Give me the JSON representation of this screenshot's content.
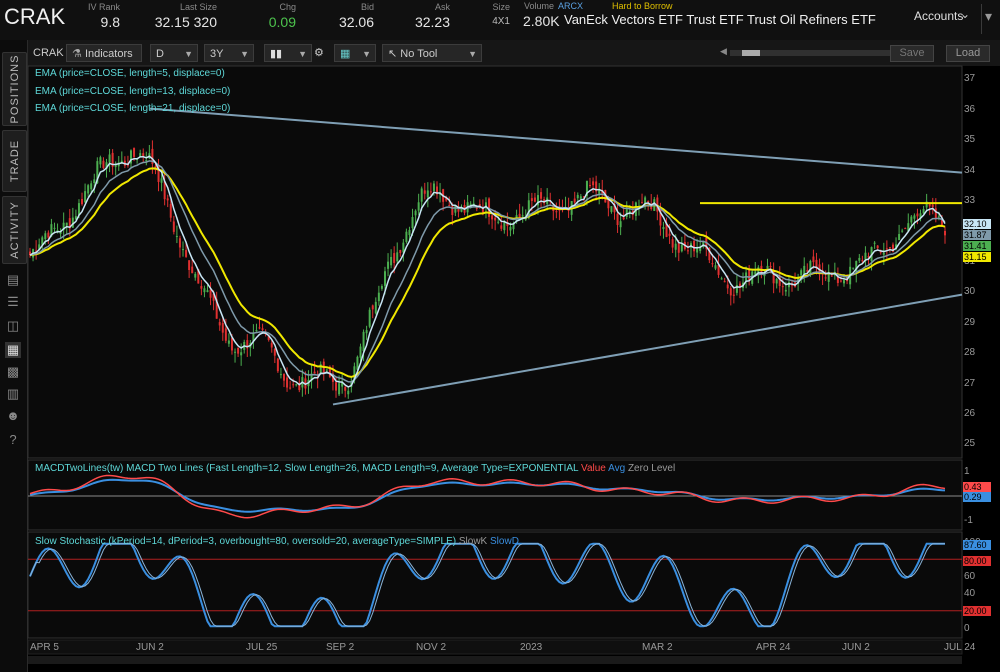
{
  "header": {
    "symbol": "CRAK",
    "ivrank_label": "IV Rank",
    "ivrank": "9.8",
    "lastsize_label": "Last Size",
    "lastsize": "32.15 320",
    "chg_label": "Chg",
    "chg": "0.09",
    "bid_label": "Bid",
    "bid": "32.06",
    "ask_label": "Ask",
    "ask": "32.23",
    "size_label": "Size",
    "size": "4X1",
    "volume_label": "Volume",
    "exchange": "ARCX",
    "volume": "2.80K",
    "htb": "Hard to Borrow",
    "description": "VanEck Vectors ETF Trust ETF Trust Oil Refiners ETF",
    "accounts": "Accounts"
  },
  "sidebar": {
    "tabs": [
      "POSITIONS",
      "TRADE",
      "ACTIVITY"
    ]
  },
  "toolbar": {
    "symbol": "CRAK",
    "studies": "Indicators",
    "aggregation": "D",
    "period": "3Y",
    "drawing_tool": "No Tool",
    "save": "Save",
    "load": "Load"
  },
  "studies": {
    "ema5": "EMA (price=CLOSE, length=5, displace=0)",
    "ema13": "EMA (price=CLOSE, length=13, displace=0)",
    "ema21": "EMA (price=CLOSE, length=21, displace=0)",
    "macd": "MACDTwoLines(tw) MACD Two Lines (Fast Length=12, Slow Length=26, MACD Length=9, Average Type=EXPONENTIAL",
    "macd_value": "Value",
    "macd_avg": "Avg",
    "macd_zero": "Zero Level",
    "stoch": "Slow Stochastic (kPeriod=14, dPeriod=3, overbought=80, oversold=20, averageType=SIMPLE)",
    "stoch_k": "SlowK",
    "stoch_d": "SlowD"
  },
  "price_axis": [
    "37",
    "36",
    "35",
    "34",
    "33",
    "32",
    "31",
    "30",
    "29",
    "28",
    "27",
    "26",
    "25"
  ],
  "price_tags": {
    "ema5": "32.10",
    "ema13": "31.87",
    "last": "31.41",
    "ema21": "31.15"
  },
  "macd_axis": [
    "1",
    "0",
    "-1"
  ],
  "macd_tags": {
    "value": "0.43",
    "avg": "0.29"
  },
  "stoch_axis": [
    "100",
    "80",
    "60",
    "40",
    "20",
    "0"
  ],
  "stoch_tags": {
    "k": "87.60",
    "ob": "80.00",
    "os": "20.00"
  },
  "time_axis": [
    "APR 5",
    "JUN 2",
    "JUL 25",
    "SEP 2",
    "NOV 2",
    "2023",
    "MAR 2",
    "APR 24",
    "JUN 2",
    "JUL 24"
  ],
  "colors": {
    "up": "#4caf50",
    "down": "#e03030",
    "ema5": "#c8e6f5",
    "ema13": "#7f9aaa",
    "ema21": "#f0e800",
    "trend": "#7f9fb5",
    "resistance": "#f0e800",
    "macd_value": "#ff4a4a",
    "macd_avg": "#3a8fe0",
    "stoch_line": "#3a8fe0",
    "stoch_band": "#b02020"
  },
  "chart_data": [
    {
      "type": "line",
      "title": "CRAK daily candlestick",
      "x": [
        "APR 5",
        "JUN 2",
        "JUL 25",
        "SEP 2",
        "NOV 2",
        "2023",
        "MAR 2",
        "APR 24",
        "JUN 2",
        "JUL 24"
      ],
      "series": [
        {
          "name": "CLOSE",
          "values": [
            31.0,
            34.5,
            28.2,
            26.9,
            33.0,
            32.4,
            32.6,
            30.1,
            30.6,
            32.15
          ]
        }
      ],
      "ylim": [
        25,
        37
      ],
      "trendlines": [
        {
          "from": [
            "JUN 2",
            35.8
          ],
          "to": [
            "JUL 24",
            33.7
          ]
        },
        {
          "from": [
            "SEP 2",
            26.1
          ],
          "to": [
            "JUL 24",
            29.7
          ]
        },
        {
          "from": [
            "MAR 2",
            32.7
          ],
          "to": [
            "JUL 24",
            32.7
          ]
        }
      ]
    },
    {
      "type": "line",
      "title": "MACD Two Lines",
      "series": [
        {
          "name": "Value",
          "values": [
            0.1,
            0.85,
            -0.8,
            -0.5,
            0.6,
            0.55,
            0.2,
            -0.2,
            -0.1,
            0.43
          ]
        },
        {
          "name": "Avg",
          "values": [
            0.05,
            0.7,
            -0.6,
            -0.55,
            0.5,
            0.5,
            0.25,
            -0.15,
            -0.05,
            0.29
          ]
        }
      ],
      "ylim": [
        -1.3,
        1.3
      ]
    },
    {
      "type": "line",
      "title": "Slow Stochastic",
      "series": [
        {
          "name": "SlowK",
          "values": [
            60,
            95,
            10,
            5,
            90,
            85,
            60,
            15,
            90,
            87.6
          ]
        }
      ],
      "ylim": [
        0,
        100
      ]
    }
  ]
}
